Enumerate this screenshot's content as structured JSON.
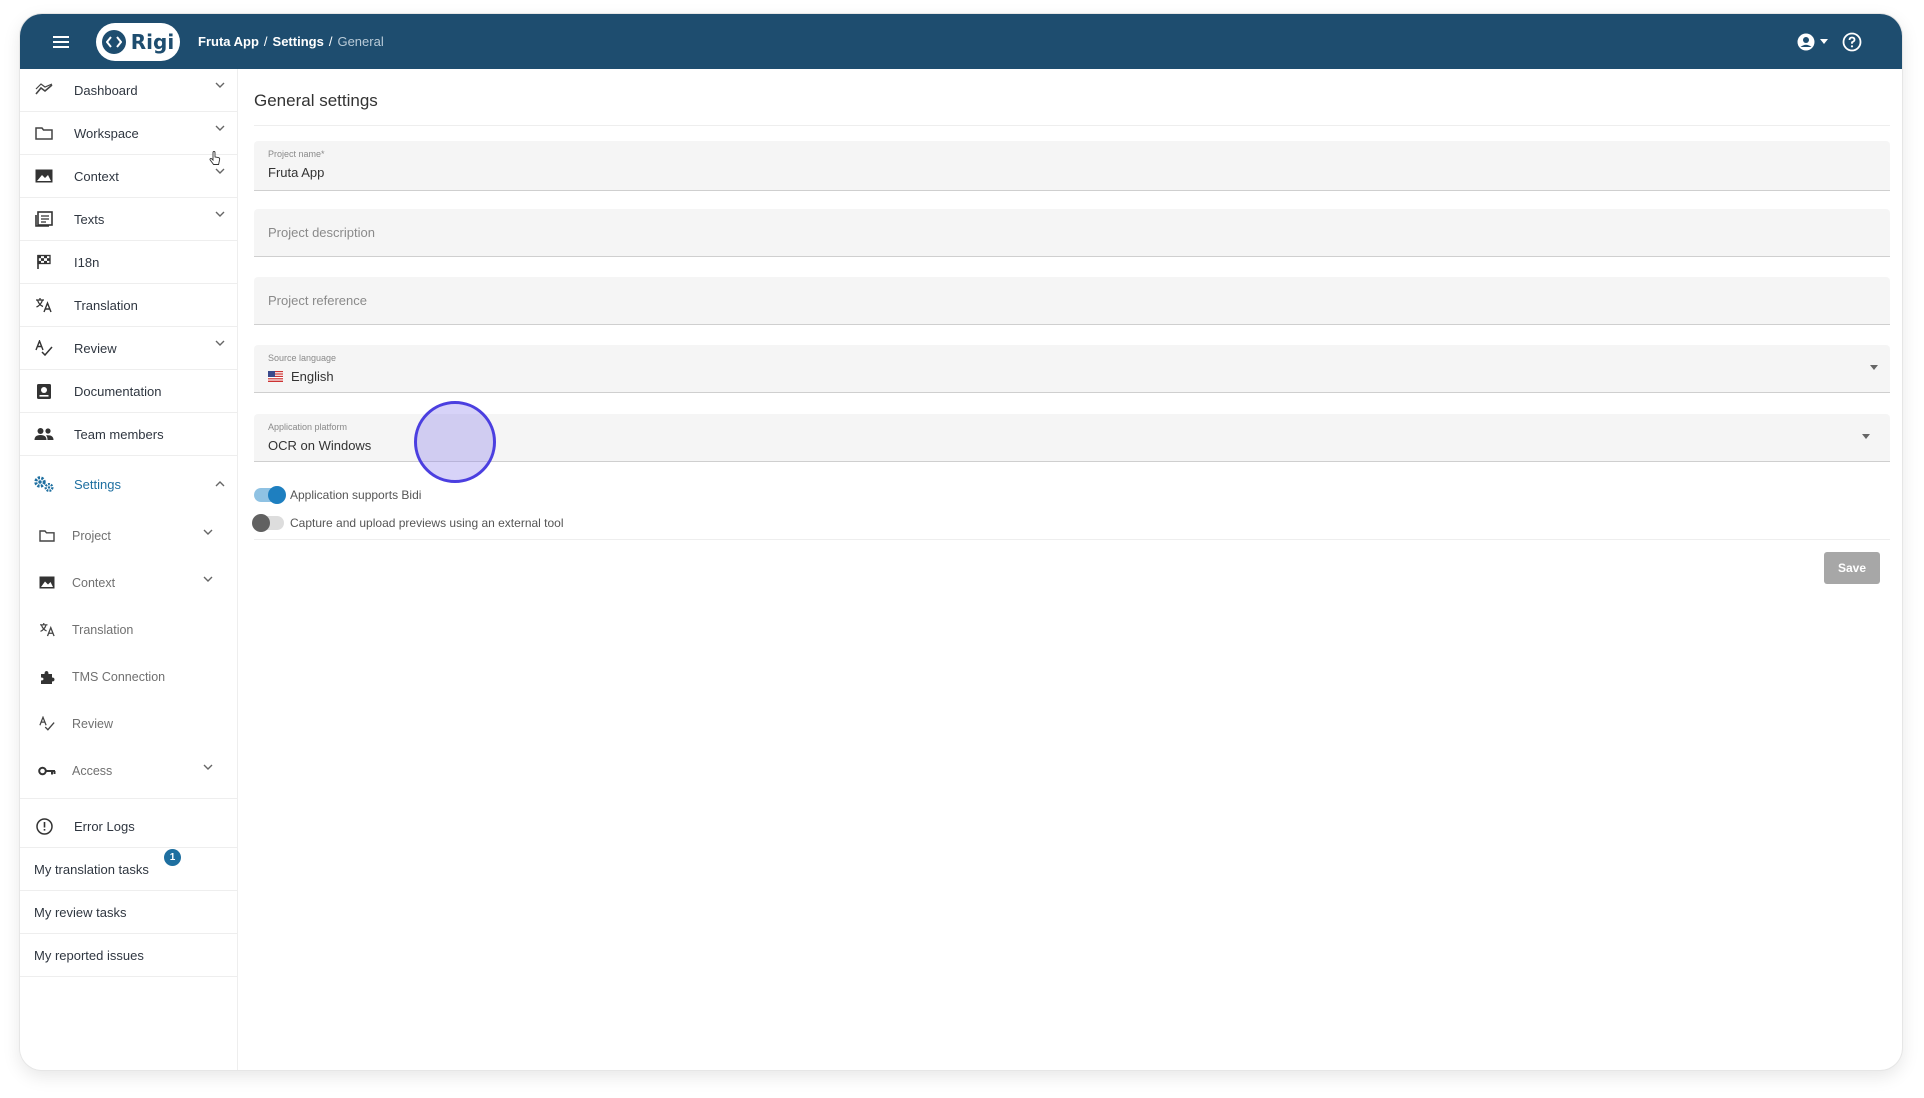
{
  "app": {
    "logo_text": "Rigi",
    "breadcrumb": [
      "Fruta App",
      "Settings",
      "General"
    ],
    "breadcrumb_separator": "/"
  },
  "sidebar": {
    "items": [
      {
        "label": "Dashboard",
        "icon": "dashboard-icon",
        "expandable": true
      },
      {
        "label": "Workspace",
        "icon": "folder-icon",
        "expandable": true
      },
      {
        "label": "Context",
        "icon": "image-icon",
        "expandable": true
      },
      {
        "label": "Texts",
        "icon": "texts-icon",
        "expandable": true
      },
      {
        "label": "I18n",
        "icon": "flag-icon",
        "expandable": false
      },
      {
        "label": "Translation",
        "icon": "translate-icon",
        "expandable": false
      },
      {
        "label": "Review",
        "icon": "spellcheck-icon",
        "expandable": true
      },
      {
        "label": "Documentation",
        "icon": "book-icon",
        "expandable": false
      },
      {
        "label": "Team members",
        "icon": "people-icon",
        "expandable": false
      }
    ],
    "settings": {
      "label": "Settings",
      "icon": "settings-icon",
      "sub_items": [
        {
          "label": "Project",
          "icon": "folder-icon",
          "expandable": true
        },
        {
          "label": "Context",
          "icon": "image-icon",
          "expandable": true
        },
        {
          "label": "Translation",
          "icon": "translate-icon",
          "expandable": false
        },
        {
          "label": "TMS Connection",
          "icon": "puzzle-icon",
          "expandable": false
        },
        {
          "label": "Review",
          "icon": "spellcheck-icon",
          "expandable": false
        },
        {
          "label": "Access",
          "icon": "key-icon",
          "expandable": true
        }
      ]
    },
    "error_logs": {
      "label": "Error Logs",
      "icon": "alert-circle-icon"
    },
    "tasks": [
      {
        "label": "My translation tasks",
        "badge": "1"
      },
      {
        "label": "My review tasks"
      },
      {
        "label": "My reported issues"
      }
    ]
  },
  "main": {
    "title": "General settings",
    "project_name": {
      "label": "Project name*",
      "value": "Fruta App"
    },
    "project_description": {
      "placeholder": "Project description"
    },
    "project_reference": {
      "placeholder": "Project reference"
    },
    "source_language": {
      "label": "Source language",
      "value": "English",
      "flag": "us-flag-icon"
    },
    "application_platform": {
      "label": "Application platform",
      "value": "OCR on Windows"
    },
    "toggles": [
      {
        "label": "Application supports Bidi",
        "on": true
      },
      {
        "label": "Capture and upload previews using an external tool",
        "on": false
      }
    ],
    "save_label": "Save"
  },
  "colors": {
    "header": "#1e4d6f",
    "accent": "#1e6fa0",
    "save_disabled": "#a7a7a7",
    "click_highlight": "#4b3fe0"
  }
}
